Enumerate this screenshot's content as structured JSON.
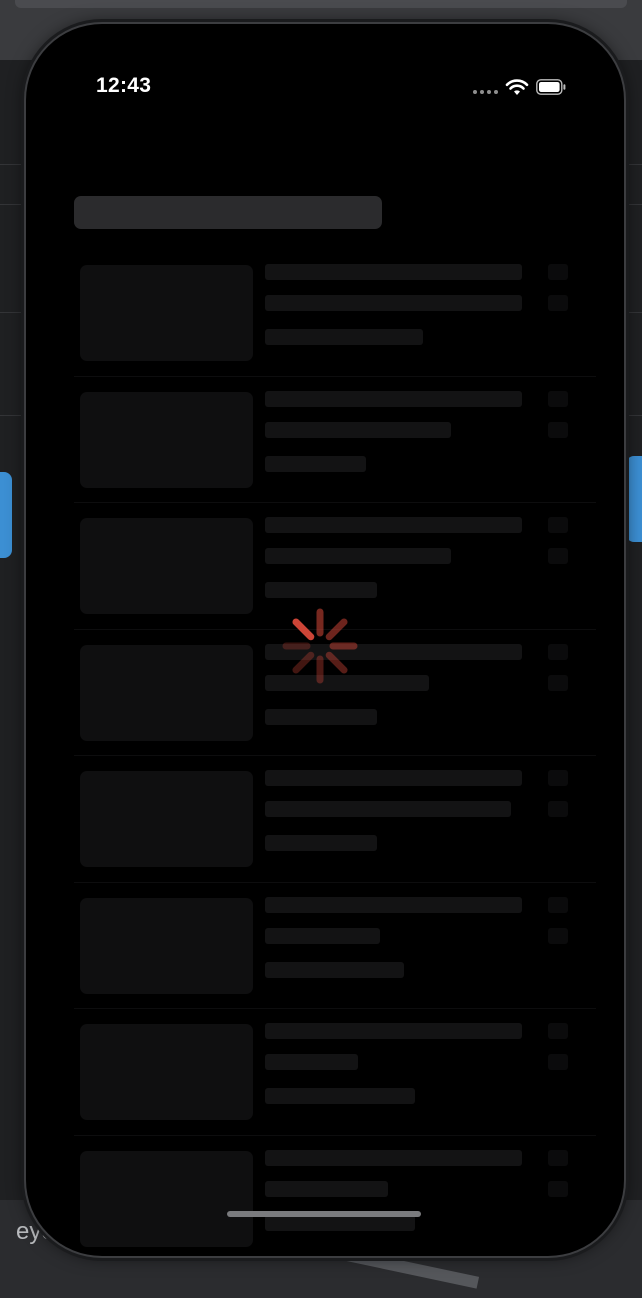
{
  "status_bar": {
    "time": "12:43"
  },
  "background_app": {
    "bottom_text": "eye"
  },
  "screen": {
    "state": "loading",
    "skeleton_rows": [
      {
        "lines": [
          0.94,
          0.94,
          0.58
        ]
      },
      {
        "lines": [
          0.94,
          0.68,
          0.37
        ]
      },
      {
        "lines": [
          0.94,
          0.68,
          0.41
        ]
      },
      {
        "lines": [
          0.94,
          0.6,
          0.41
        ]
      },
      {
        "lines": [
          0.94,
          0.9,
          0.41
        ]
      },
      {
        "lines": [
          0.94,
          0.42,
          0.51
        ]
      },
      {
        "lines": [
          0.94,
          0.34,
          0.55
        ]
      },
      {
        "lines": [
          0.94,
          0.45,
          0.55
        ]
      }
    ]
  },
  "colors": {
    "spinner_accent": "#d9493a",
    "screen_bg": "#000000",
    "skeleton": "#131314"
  },
  "icons": [
    "cellular-signal-icon",
    "wifi-icon",
    "battery-icon",
    "loading-spinner-icon"
  ]
}
